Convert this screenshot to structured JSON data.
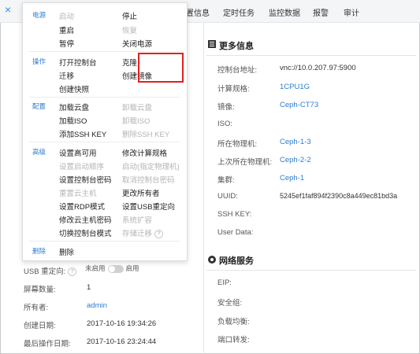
{
  "top_tabs": [
    "置信息",
    "定时任务",
    "监控数据",
    "报警",
    "审计"
  ],
  "close_icon": "×",
  "more_info": {
    "title": "更多信息",
    "fields": [
      {
        "label": "控制台地址:",
        "value": "vnc://10.0.207.97:5900",
        "is_link": false
      },
      {
        "label": "计算规格:",
        "value": "1CPU1G",
        "is_link": true
      },
      {
        "label": "镜像:",
        "value": "Ceph-CT73",
        "is_link": true
      },
      {
        "label": "ISO:",
        "value": "",
        "is_link": false
      },
      {
        "label": "所在物理机:",
        "value": "Ceph-1-3",
        "is_link": true
      },
      {
        "label": "上次所在物理机:",
        "value": "Ceph-2-2",
        "is_link": true
      },
      {
        "label": "集群:",
        "value": "Ceph-1",
        "is_link": true
      },
      {
        "label": "UUID:",
        "value": "5245ef1faf894f2390c8a449ec81bd3a",
        "is_link": false
      },
      {
        "label": "SSH KEY:",
        "value": "",
        "is_link": false
      },
      {
        "label": "User Data:",
        "value": "",
        "is_link": false
      }
    ]
  },
  "network": {
    "title": "网络服务",
    "fields": [
      {
        "label": "EIP:"
      },
      {
        "label": "安全组:"
      },
      {
        "label": "负载均衡:"
      },
      {
        "label": "端口转发:"
      }
    ]
  },
  "menu": {
    "groups": {
      "power": "电源",
      "operation": "操作",
      "config": "配置",
      "advanced": "高级",
      "delete": "删除"
    },
    "power": {
      "start": "启动",
      "stop": "停止",
      "restart": "重启",
      "resume": "恢复",
      "pause": "暂停",
      "poweroff": "关闭电源"
    },
    "operation": {
      "console": "打开控制台",
      "clone": "克隆",
      "migrate": "迁移",
      "create_image": "创建镜像",
      "snapshot": "创建快照"
    },
    "config": {
      "load_volume": "加载云盘",
      "unload_volume": "卸载云盘",
      "load_iso": "加载ISO",
      "unload_iso": "卸载ISO",
      "add_ssh": "添加SSH KEY",
      "del_ssh": "删除SSH KEY"
    },
    "advanced": {
      "ha": "设置高可用",
      "spec": "修改计算规格",
      "boot_order": "设置启动顺序",
      "boot_host": "启动(指定物理机)",
      "console_pwd": "设置控制台密码",
      "cancel_console_pwd": "取消控制台密码",
      "rebuild": "重置云主机",
      "owner": "更改所有者",
      "rdp": "设置RDP模式",
      "usb": "设置USB重定向",
      "vm_pwd": "修改云主机密码",
      "expand": "系统扩容",
      "console_mode": "切换控制台模式",
      "storage_migrate": "存储迁移"
    },
    "delete": "删除"
  },
  "basic": {
    "usb_label": "USB 重定向:",
    "usb_off": "未启用",
    "usb_on": "启用",
    "screens_label": "屏幕数量:",
    "screens_value": "1",
    "owner_label": "所有者:",
    "owner_value": "admin",
    "created_label": "创建日期:",
    "created_value": "2017-10-16 19:34:26",
    "last_op_label": "最后操作日期:",
    "last_op_value": "2017-10-16 23:24:44"
  },
  "help_icon": "?",
  "colors": {
    "accent": "#2d7dd2",
    "highlight_box": "#e02020",
    "disabled": "#b4b4b4"
  }
}
